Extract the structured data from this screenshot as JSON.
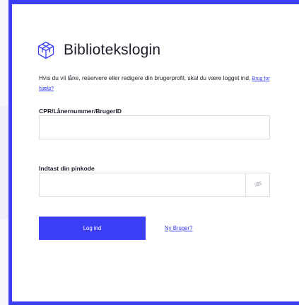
{
  "login": {
    "title": "Bibliotekslogin",
    "intro_text": "Hvis du vil låne, reservere eller redigere din brugerprofil, skal du være logget ind.",
    "help_link": "Brug for hjælp?",
    "cpr_label": "CPR/Lånernummer/BrugerID",
    "cpr_value": "",
    "pin_label": "Indtast din pinkode",
    "pin_value": "",
    "login_button": "Log ind",
    "new_user_link": "Ny Bruger?"
  },
  "icons": {
    "logo": "cube-icon",
    "password_toggle": "eye-slash-icon"
  },
  "colors": {
    "accent": "#3b3ef5",
    "text": "#1d1d2b",
    "border": "#dcdce4"
  }
}
